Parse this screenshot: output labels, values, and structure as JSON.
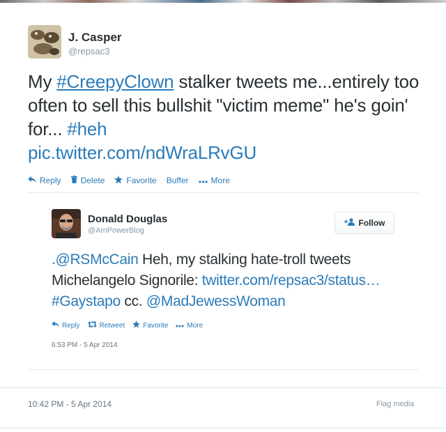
{
  "tweet": {
    "author_name": "J. Casper",
    "author_handle": "@repsac3",
    "text_my": "My ",
    "text_hashtag_clown": "#CreepyClown",
    "text_middle": " stalker tweets me...entirely too often to sell this bullshit \"victim meme\" he's goin' for... ",
    "text_hashtag_heh": "#heh",
    "text_link": "pic.twitter.com/ndWraLRvGU",
    "actions": {
      "reply": "Reply",
      "delete": "Delete",
      "favorite": "Favorite",
      "buffer": "Buffer",
      "more": "More"
    },
    "timestamp": "10:42 PM - 5 Apr 2014",
    "flag_media": "Flag media"
  },
  "embedded": {
    "author_name": "Donald Douglas",
    "author_handle": "@AmPowerBlog",
    "follow_label": "Follow",
    "text_mention1": ".@RSMcCain",
    "text_part1": " Heh, my stalking hate-troll tweets Michelangelo Signorile: ",
    "text_link": "twitter.com/repsac3/status…",
    "text_space": " ",
    "text_hashtag": "#Gaystapo",
    "text_cc": " cc. ",
    "text_mention2": "@MadJewessWoman",
    "actions": {
      "reply": "Reply",
      "retweet": "Retweet",
      "favorite": "Favorite",
      "more": "More"
    },
    "date": "6:53 PM - 5 Apr 2014"
  },
  "colors": {
    "link": "#2b7bb9",
    "text": "#292f33",
    "muted": "#8899a6",
    "border": "#e1e8ed"
  },
  "icons": [
    "reply-icon",
    "trash-icon",
    "star-icon",
    "ellipsis-icon",
    "follow-person-icon",
    "retweet-icon"
  ]
}
